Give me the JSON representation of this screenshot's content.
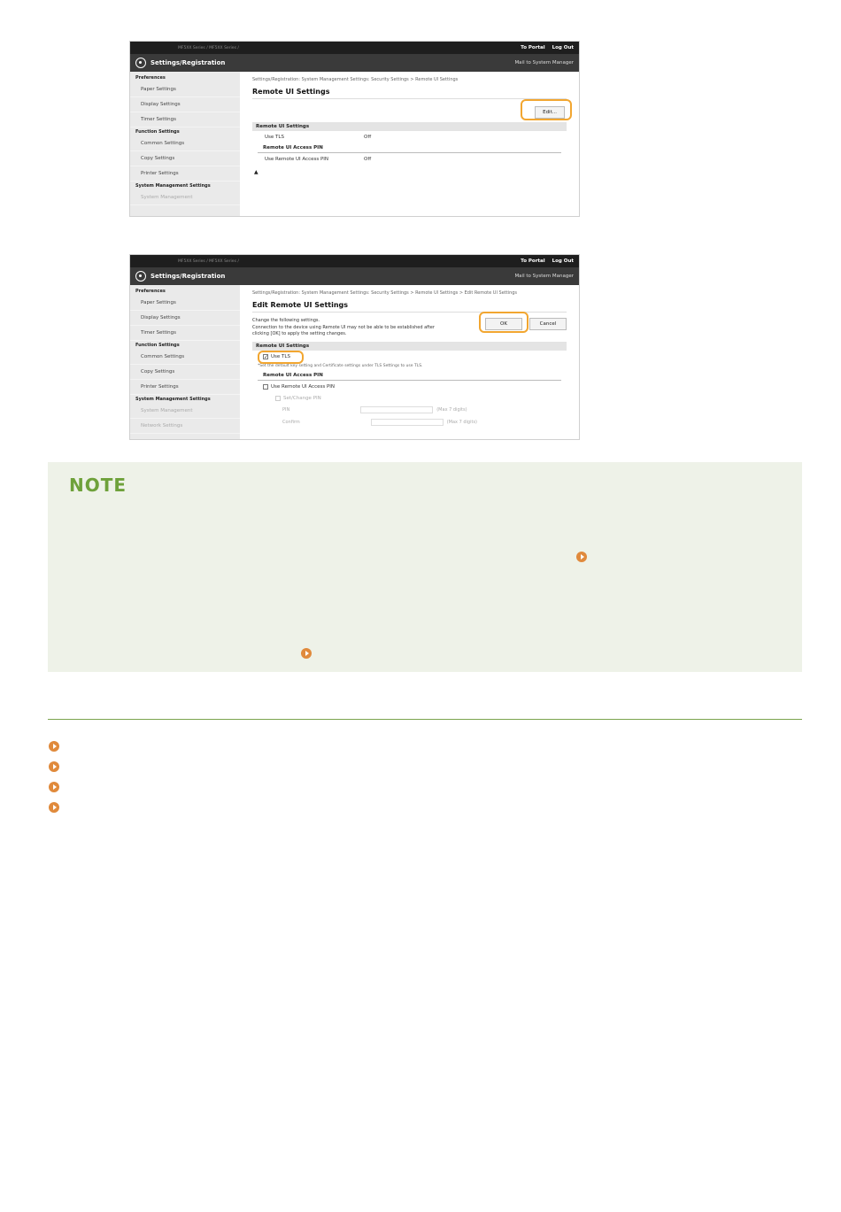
{
  "screen_common": {
    "model": "MF5XX Series / MF5XX Series /",
    "to_portal": "To Portal",
    "log_out": "Log Out",
    "app_title": "Settings/Registration",
    "mail": "Mail to System Manager"
  },
  "screen1": {
    "sidebar": [
      {
        "type": "sec",
        "label": "Preferences"
      },
      {
        "type": "item",
        "label": "Paper Settings"
      },
      {
        "type": "item",
        "label": "Display Settings"
      },
      {
        "type": "item",
        "label": "Timer Settings"
      },
      {
        "type": "sec",
        "label": "Function Settings"
      },
      {
        "type": "item",
        "label": "Common Settings"
      },
      {
        "type": "item",
        "label": "Copy Settings"
      },
      {
        "type": "item",
        "label": "Printer Settings"
      },
      {
        "type": "sec",
        "label": "System Management Settings"
      },
      {
        "type": "item",
        "label": "System Management",
        "faded": true
      }
    ],
    "breadcrumb": "Settings/Registration: System Management Settings: Security Settings > Remote UI Settings",
    "title": "Remote UI Settings",
    "edit_button": "Edit...",
    "section1": "Remote UI Settings",
    "use_tls_label": "Use TLS",
    "use_tls_value": "Off",
    "section2": "Remote UI Access PIN",
    "use_pin_label": "Use Remote UI Access PIN",
    "use_pin_value": "Off",
    "top_icon": "▲"
  },
  "screen2": {
    "sidebar": [
      {
        "type": "sec",
        "label": "Preferences"
      },
      {
        "type": "item",
        "label": "Paper Settings"
      },
      {
        "type": "item",
        "label": "Display Settings"
      },
      {
        "type": "item",
        "label": "Timer Settings"
      },
      {
        "type": "sec",
        "label": "Function Settings"
      },
      {
        "type": "item",
        "label": "Common Settings"
      },
      {
        "type": "item",
        "label": "Copy Settings"
      },
      {
        "type": "item",
        "label": "Printer Settings"
      },
      {
        "type": "sec",
        "label": "System Management Settings"
      },
      {
        "type": "item",
        "label": "System Management",
        "faded": true
      },
      {
        "type": "item",
        "label": "Network Settings",
        "faded": true
      }
    ],
    "breadcrumb": "Settings/Registration: System Management Settings: Security Settings > Remote UI Settings > Edit Remote UI Settings",
    "title": "Edit Remote UI Settings",
    "desc_line1": "Change the following settings.",
    "desc_line2": "Connection to the device using Remote UI may not be able to be established after",
    "desc_line3": "clicking [OK] to apply the setting changes.",
    "ok_button": "OK",
    "cancel_button": "Cancel",
    "section1": "Remote UI Settings",
    "use_tls_label": "Use TLS",
    "use_tls_hint": "*Set the default key setting and Certificate settings under TLS Settings to use TLS.",
    "section2": "Remote UI Access PIN",
    "use_pin_label": "Use Remote UI Access PIN",
    "set_pin_label": "Set/Change PIN",
    "pin_label": "PIN",
    "pin_max": "(Max 7 digits)",
    "confirm_label": "Confirm",
    "confirm_max": "(Max 7 digits)"
  },
  "note": {
    "title": "NOTE"
  }
}
